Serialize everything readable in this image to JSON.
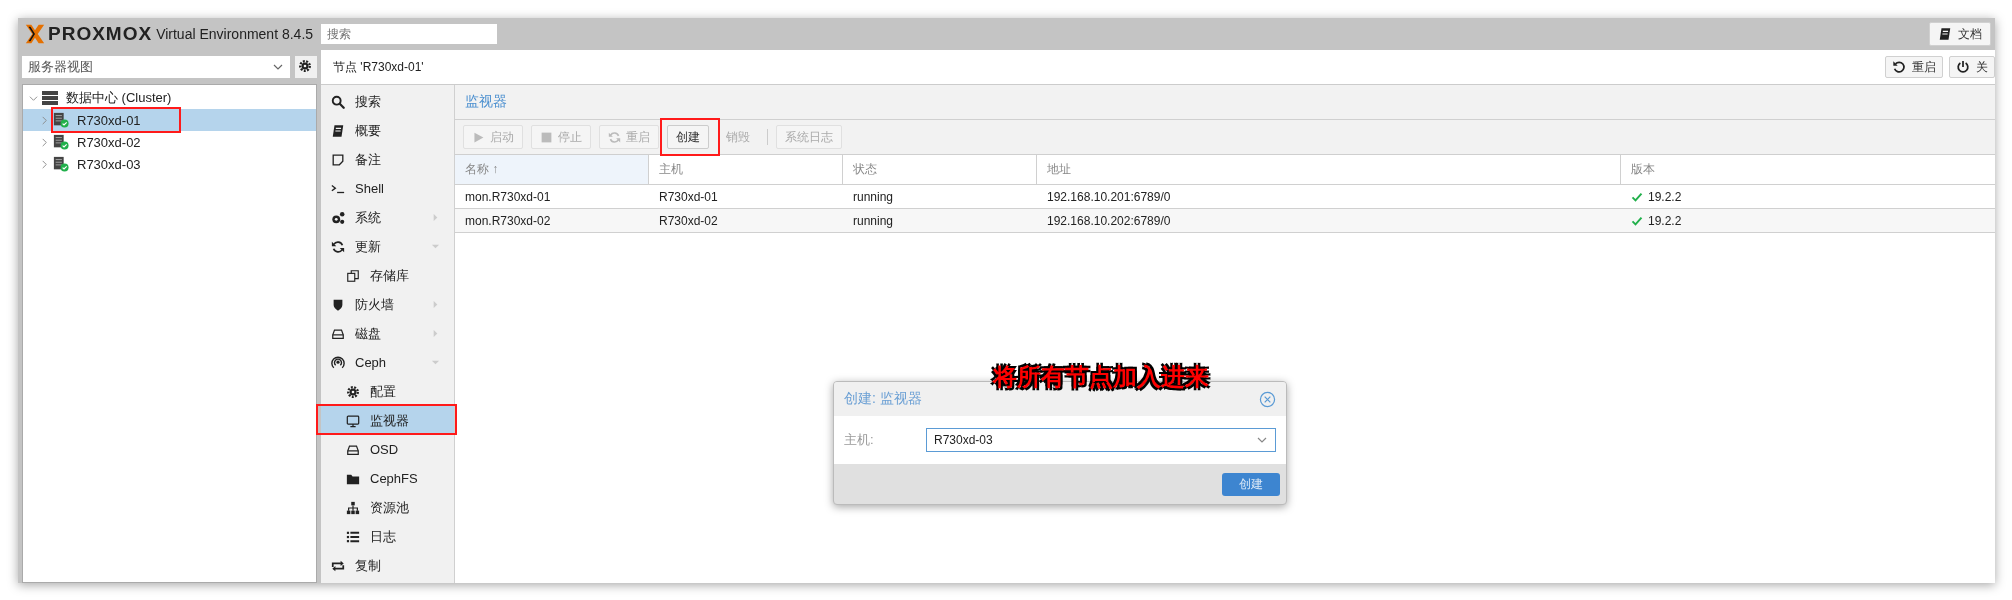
{
  "topbar": {
    "logo": "PROXMOX",
    "product": "Virtual Environment 8.4.5",
    "search": {
      "placeholder": "搜索"
    },
    "docs_button": "文档"
  },
  "view_select": {
    "value": "服务器视图"
  },
  "tree": [
    {
      "label": "数据中心 (Cluster)",
      "expanded": true,
      "selected": false,
      "highlighted": false,
      "children": [
        {
          "label": "R730xd-01",
          "expanded": false,
          "selected": true,
          "highlighted": true
        },
        {
          "label": "R730xd-02",
          "expanded": false,
          "selected": false,
          "highlighted": false
        },
        {
          "label": "R730xd-03",
          "expanded": false,
          "selected": false,
          "highlighted": false
        }
      ]
    }
  ],
  "header": {
    "title": "节点 'R730xd-01'",
    "buttons": [
      "重启",
      "关"
    ]
  },
  "menu": [
    {
      "label": "搜索",
      "selected": false,
      "highlighted": false
    },
    {
      "label": "概要",
      "selected": false,
      "highlighted": false
    },
    {
      "label": "备注",
      "selected": false,
      "highlighted": false
    },
    {
      "label": "Shell",
      "selected": false,
      "highlighted": false
    },
    {
      "label": "系统",
      "selected": false,
      "highlighted": false,
      "expanded": false
    },
    {
      "label": "更新",
      "selected": false,
      "highlighted": false,
      "expanded": true,
      "children": [
        {
          "label": "存储库",
          "selected": false,
          "highlighted": false
        }
      ]
    },
    {
      "label": "防火墙",
      "selected": false,
      "highlighted": false,
      "expanded": false
    },
    {
      "label": "磁盘",
      "selected": false,
      "highlighted": false,
      "expanded": false
    },
    {
      "label": "Ceph",
      "selected": false,
      "highlighted": false,
      "expanded": true,
      "children": [
        {
          "label": "配置",
          "selected": false,
          "highlighted": false
        },
        {
          "label": "监视器",
          "selected": true,
          "highlighted": true
        },
        {
          "label": "OSD",
          "selected": false,
          "highlighted": false
        },
        {
          "label": "CephFS",
          "selected": false,
          "highlighted": false
        },
        {
          "label": "资源池",
          "selected": false,
          "highlighted": false
        },
        {
          "label": "日志",
          "selected": false,
          "highlighted": false
        }
      ]
    },
    {
      "label": "复制",
      "selected": false,
      "highlighted": false
    }
  ],
  "panel": {
    "title": "监视器",
    "toolbar": [
      {
        "label": "启动",
        "disabled": true,
        "highlighted": false
      },
      {
        "label": "停止",
        "disabled": true,
        "highlighted": false
      },
      {
        "label": "重启",
        "disabled": true,
        "highlighted": false
      },
      {
        "label": "创建",
        "disabled": false,
        "highlighted": true
      },
      {
        "label": "销毁",
        "disabled": true,
        "highlighted": false
      },
      {
        "label": "系统日志",
        "disabled": true,
        "highlighted": false
      }
    ],
    "table": {
      "columns": [
        "名称 ↑",
        "主机",
        "状态",
        "地址",
        "版本"
      ],
      "rows": [
        [
          "mon.R730xd-01",
          "R730xd-01",
          "running",
          "192.168.10.201:6789/0",
          "19.2.2"
        ],
        [
          "mon.R730xd-02",
          "R730xd-02",
          "running",
          "192.168.10.202:6789/0",
          "19.2.2"
        ]
      ]
    }
  },
  "dialog": {
    "title": "创建: 监视器",
    "field_label": "主机:",
    "field_value": "R730xd-03",
    "button": "创建"
  },
  "annotation": "将所有节点加入进来"
}
